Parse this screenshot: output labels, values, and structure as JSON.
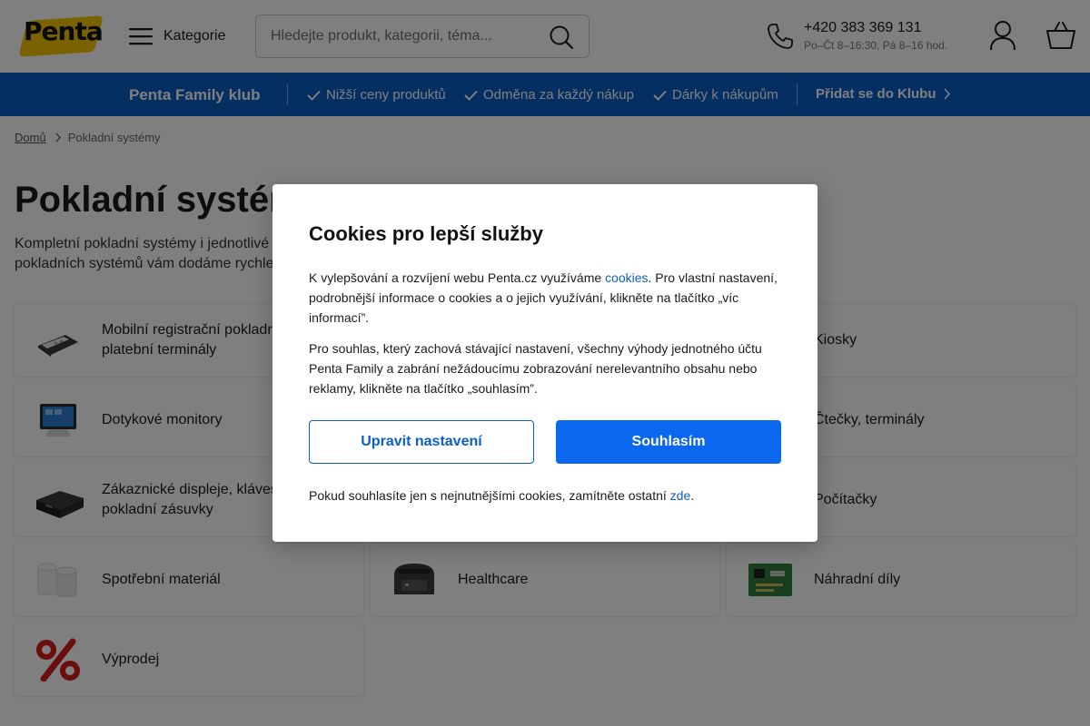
{
  "header": {
    "logo_text": "Penta",
    "categories_label": "Kategorie",
    "search_placeholder": "Hledejte produkt, kategorii, téma...",
    "phone_number": "+420 383 369 131",
    "phone_hours": "Po–Čt 8–16:30, Pá 8–16 hod."
  },
  "club_bar": {
    "title": "Penta Family klub",
    "benefits": [
      "Nižší ceny produktů",
      "Odměna za každý nákup",
      "Dárky k nákupům"
    ],
    "join_label": "Přidat se do Klubu"
  },
  "breadcrumb": {
    "home": "Domů",
    "current": "Pokladní systémy"
  },
  "page": {
    "title": "Pokladní systémy",
    "intro_line1": "Kompletní pokladní systémy i jednotlivé",
    "intro_line2": "pokladních systémů vám dodáme rychle"
  },
  "categories": [
    {
      "label_line1": "Mobilní registrační pokladny",
      "label_line2": "platební terminály",
      "icon": "mobile-pos-icon"
    },
    {
      "label_line1": "Kiosky",
      "label_line2": "",
      "icon": "kiosk-icon"
    },
    {
      "label_line1": "Dotykové monitory",
      "label_line2": "",
      "icon": "touch-monitor-icon"
    },
    {
      "label_line1": "Čtečky, terminály",
      "label_line2": "",
      "icon": "scanner-icon"
    },
    {
      "label_line1": "Zákaznické displeje, klávesnice",
      "label_line2": "pokladní zásuvky",
      "icon": "cash-drawer-icon"
    },
    {
      "label_line1": "Počítačky",
      "label_line2": "",
      "icon": "counter-icon"
    },
    {
      "label_line1": "Spotřební materiál",
      "label_line2": "",
      "icon": "paper-rolls-icon"
    },
    {
      "label_line1": "Healthcare",
      "label_line2": "",
      "icon": "label-printer-icon"
    },
    {
      "label_line1": "Náhradní díly",
      "label_line2": "",
      "icon": "circuit-board-icon"
    },
    {
      "label_line1": "Výprodej",
      "label_line2": "",
      "icon": "percent-icon"
    }
  ],
  "cookie_modal": {
    "title": "Cookies pro lepší služby",
    "p1_before": "K vylepšování a rozvíjení webu Penta.cz využíváme ",
    "p1_link": "cookies",
    "p1_after": ". Pro vlastní nastavení, podrobnější informace o cookies a o jejich využívání, klikněte na tlačítko „víc informací”.",
    "p2": "Pro souhlas, který zachová stávající nastavení, všechny výhody jednotného účtu Penta Family a zabrání nežádoucímu zobrazování nerelevantního obsahu nebo reklamy, klikněte na tlačítko „souhlasím”.",
    "settings_button": "Upravit nastavení",
    "accept_button": "Souhlasím",
    "p3_before": "Pokud souhlasíte jen s nejnutnějšími cookies, zamítněte ostatní ",
    "p3_link": "zde",
    "p3_after": "."
  },
  "colors": {
    "brand_blue": "#0b5ec7",
    "primary_button": "#0b66f0",
    "logo_yellow": "#f5c400"
  }
}
